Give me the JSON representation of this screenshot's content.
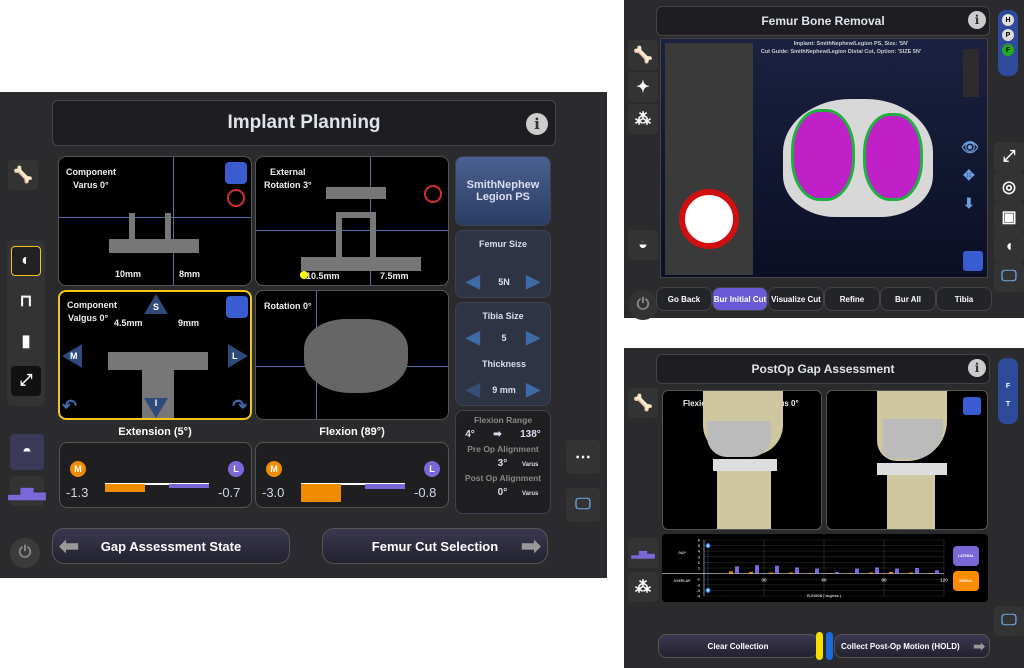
{
  "implant_planning": {
    "title": "Implant Planning",
    "views": [
      {
        "label1": "Component",
        "label2": "Varus 0°",
        "m1": "10mm",
        "m2": "8mm"
      },
      {
        "label1": "External",
        "label2": "Rotation 3°",
        "m1": "10.5mm",
        "m2": "7.5mm"
      },
      {
        "label1": "Component",
        "label2": "Valgus 0°",
        "m1": "4.5mm",
        "m2": "9mm",
        "s": "S",
        "i": "I",
        "m": "M",
        "l": "L"
      },
      {
        "label1": "Rotation 0°"
      }
    ],
    "implant_button": "SmithNephew Legion PS",
    "femur_size": {
      "label": "Femur Size",
      "value": "5N"
    },
    "tibia_size": {
      "label": "Tibia Size",
      "value": "5"
    },
    "thickness": {
      "label": "Thickness",
      "value": "9 mm"
    },
    "flexion_range": {
      "label": "Flexion Range",
      "from": "4°",
      "to": "138°"
    },
    "pre_op": {
      "label": "Pre Op Alignment",
      "value": "3°",
      "dir": "Varus"
    },
    "post_op": {
      "label": "Post Op Alignment",
      "value": "0°",
      "dir": "Varus"
    },
    "extension": {
      "title": "Extension (5°)",
      "m": "M",
      "l": "L",
      "medial": "-1.3",
      "lateral": "-0.7",
      "medial_gap": -1.3,
      "lateral_gap": -0.7
    },
    "flexion": {
      "title": "Flexion (89°)",
      "m": "M",
      "l": "L",
      "medial": "-3.0",
      "lateral": "-0.8",
      "medial_gap": -3.0,
      "lateral_gap": -0.8
    },
    "back_button": "Gap Assessment State",
    "next_button": "Femur Cut Selection",
    "colors": {
      "medial": "#f08c00",
      "lateral": "#7b68d8",
      "selected": "#f5c518"
    }
  },
  "femur_bone_removal": {
    "title": "Femur Bone Removal",
    "implant_line": "Implant: SmithNephew/Legion PS, Size: '5N'",
    "guide_line": "Cut Guide: SmithNephew/Legion Distal Cut, Option: 'SIZE 5N'",
    "side_tabs": [
      "H",
      "P",
      "F"
    ],
    "buttons": [
      "Go Back",
      "Bur Initial Cut",
      "Visualize Cut",
      "Refine",
      "Bur All",
      "Tibia"
    ],
    "active_button": "Bur Initial Cut",
    "colors": {
      "bone": "#d8d8d8",
      "cut": "#c020c8",
      "edge": "#20b040",
      "active": "#6a5ad8"
    }
  },
  "postop_gap": {
    "title": "PostOp Gap Assessment",
    "flexion_label": "Flexion  7°",
    "varus_label": "Varus 0°",
    "side_tabs": [
      "F",
      "T"
    ],
    "legend": [
      "LATERAL",
      "MEDIAL"
    ],
    "clear_button": "Clear Collection",
    "collect_button": "Collect Post-Op Motion (HOLD)"
  },
  "chart_data": {
    "type": "bar",
    "xlabel": "FLEXION  ( degrees )",
    "ylabel_top": "GAP",
    "ylabel_bottom": "OVERLAP",
    "xlim": [
      0,
      120
    ],
    "ylim": [
      -4,
      6
    ],
    "xticks": [
      30,
      60,
      90,
      120
    ],
    "yticks": [
      6,
      5,
      4,
      3,
      2,
      1,
      -1,
      -2,
      -3,
      -4
    ],
    "x": [
      15,
      25,
      35,
      45,
      55,
      65,
      75,
      85,
      95,
      105,
      115
    ],
    "series": [
      {
        "name": "LATERAL",
        "color": "#7b68d8",
        "values": [
          1.3,
          1.5,
          1.4,
          1.1,
          0.9,
          0.3,
          0.9,
          1.1,
          0.9,
          1.0,
          0.6
        ]
      },
      {
        "name": "MEDIAL",
        "color": "#f08c00",
        "values": [
          0.4,
          0.3,
          0.2,
          0.2,
          0.1,
          0.1,
          0.1,
          0.2,
          0.3,
          0.2,
          0.1
        ]
      }
    ],
    "marker_range": [
      -3,
      5
    ],
    "marker_label": "N"
  }
}
